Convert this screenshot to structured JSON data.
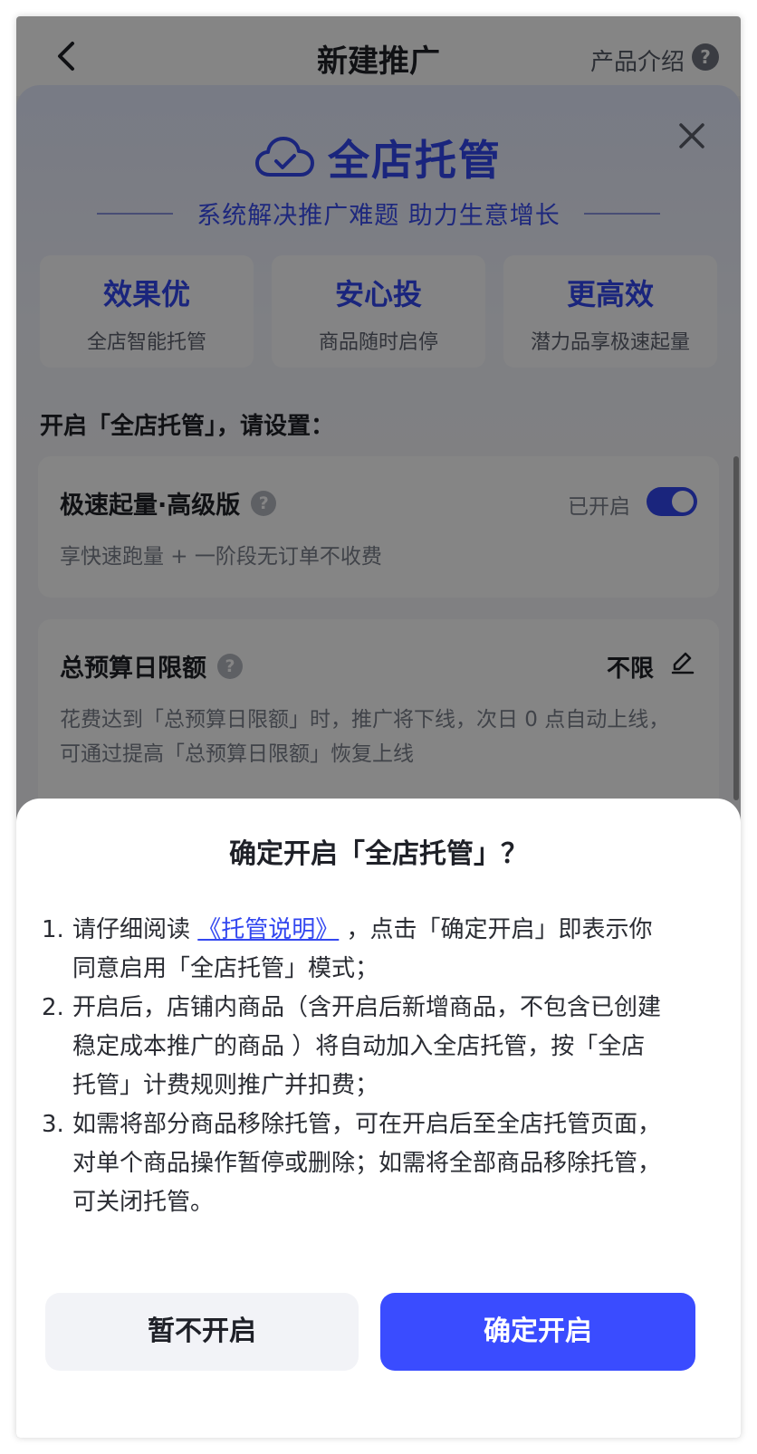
{
  "nav": {
    "title": "新建推广",
    "intro_label": "产品介绍",
    "help_icon": "?"
  },
  "sheet": {
    "brand": "全店托管",
    "slogan": "系统解决推广难题 助力生意增长",
    "features": [
      {
        "title": "效果优",
        "sub": "全店智能托管"
      },
      {
        "title": "安心投",
        "sub": "商品随时启停"
      },
      {
        "title": "更高效",
        "sub": "潜力品享极速起量"
      }
    ],
    "setting_prompt": "开启「全店托管」，请设置：",
    "speed_card": {
      "title": "极速起量·高级版",
      "toggle_label": "已开启",
      "toggle_on": true,
      "desc": "享快速跑量 + 一阶段无订单不收费"
    },
    "budget_card": {
      "title": "总预算日限额",
      "value": "不限",
      "desc_line1": "花费达到「总预算日限额」时，推广将下线，次日 0 点自动上线，",
      "desc_line2": "可通过提高「总预算日限额」恢复上线"
    },
    "question_mark": "?"
  },
  "dialog": {
    "title": "确定开启「全店托管」？",
    "terms": [
      {
        "num": "1.",
        "line1_prefix": "请仔细阅读 ",
        "link": "《托管说明》",
        "line1_suffix": " ，点击「确定开启」即表示你",
        "line2": "同意启用「全店托管」模式；"
      },
      {
        "num": "2.",
        "line1": "开启后，店铺内商品（含开启后新增商品，不包含已创建",
        "line2": "稳定成本推广的商品 ）将自动加入全店托管，按「全店",
        "line3": "托管」计费规则推广并扣费；"
      },
      {
        "num": "3.",
        "line1": "如需将部分商品移除托管，可在开启后至全店托管页面，",
        "line2": "对单个商品操作暂停或删除；如需将全部商品移除托管，",
        "line3": "可关闭托管。"
      }
    ],
    "cancel_label": "暂不开启",
    "confirm_label": "确定开启"
  },
  "colors": {
    "accent": "#3347f0",
    "confirm_button": "#3a4cff",
    "overlay": "rgba(0,0,0,0.48)"
  },
  "icons": {
    "back": "chevron-left-icon",
    "close": "close-icon",
    "brand": "cloud-check-icon",
    "edit": "pencil-icon",
    "help": "question-circle-icon"
  }
}
